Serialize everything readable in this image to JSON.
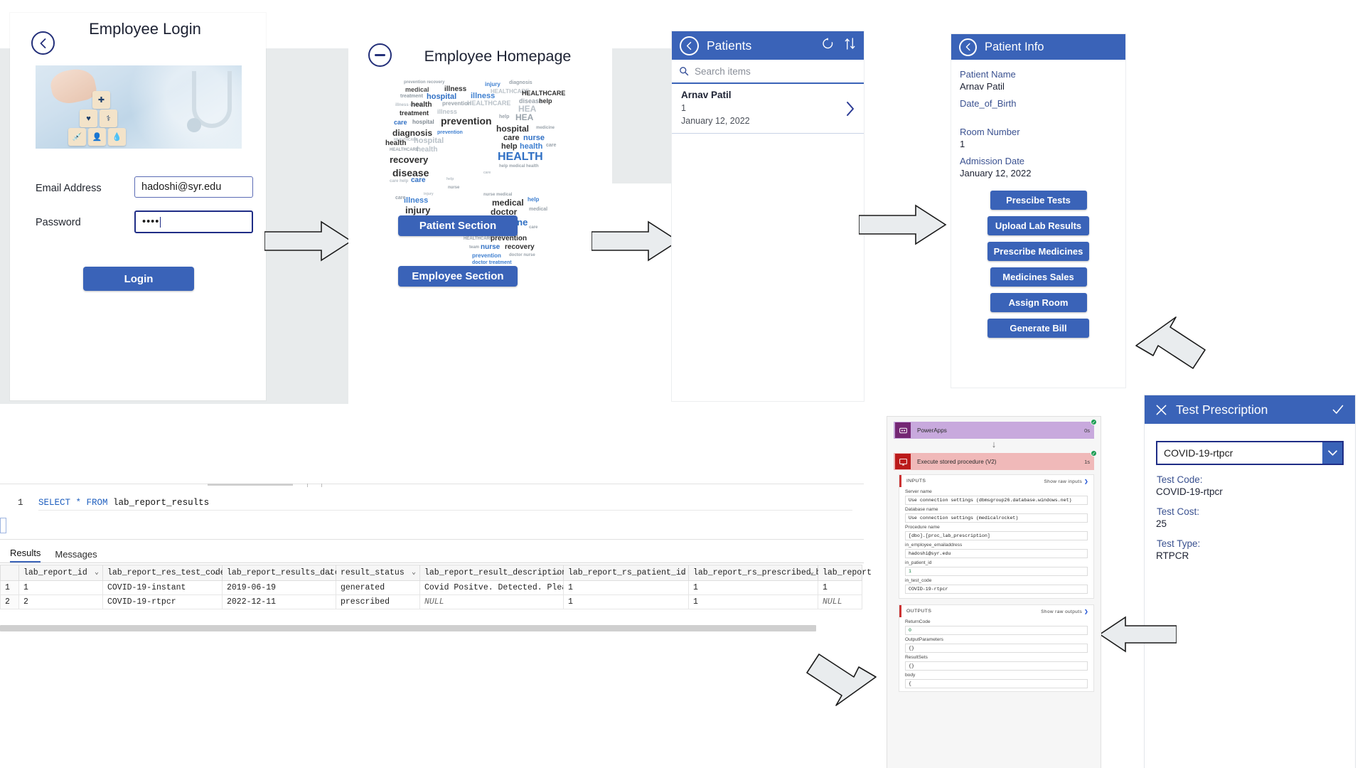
{
  "login": {
    "title": "Employee Login",
    "back_icon": "chevron-left-icon",
    "image_alt": "healthcare-blocks-photo",
    "fields": [
      {
        "label": "Email Address",
        "value": "hadoshi@syr.edu",
        "placeholder": ""
      },
      {
        "label": "Password",
        "value": "••••",
        "placeholder": ""
      }
    ],
    "submit_label": "Login"
  },
  "homepage": {
    "title": "Employee Homepage",
    "minus_icon": "minus-circle-icon",
    "buttons": [
      "Patient Section",
      "Employee Section"
    ],
    "wordcloud": {
      "image_alt": "healthcare-word-cloud-heart",
      "words": [
        "HEALTHCARE",
        "HEALTH",
        "hospital",
        "prevention",
        "treatment",
        "diagnosis",
        "recovery",
        "disease",
        "medical",
        "medicine",
        "doctor",
        "nurse",
        "illness",
        "injury",
        "care",
        "help",
        "health"
      ]
    }
  },
  "patients": {
    "title": "Patients",
    "back_icon": "chevron-left-icon",
    "refresh_icon": "refresh-icon",
    "sort_icon": "sort-icon",
    "search_placeholder": "Search items",
    "search_icon": "search-icon",
    "items": [
      {
        "name": "Arnav Patil",
        "room": "1",
        "date": "January 12, 2022",
        "chevron": "chevron-right-icon"
      }
    ]
  },
  "patient_info": {
    "title": "Patient Info",
    "back_icon": "chevron-left-icon",
    "fields": [
      {
        "label": "Patient Name",
        "value": "Arnav Patil"
      },
      {
        "label": "Date_of_Birth",
        "value": ""
      },
      {
        "label": "Room Number",
        "value": "1"
      },
      {
        "label": "Admission Date",
        "value": "January 12, 2022"
      }
    ],
    "buttons": [
      "Prescibe Tests",
      "Upload Lab Results",
      "Prescribe Medicines",
      "Medicines Sales",
      "Assign Room",
      "Generate Bill"
    ]
  },
  "test_prescription": {
    "title": "Test Prescription",
    "close_icon": "close-icon",
    "confirm_icon": "check-icon",
    "dropdown": {
      "value": "COVID-19-rtpcr",
      "chevron": "chevron-down-icon"
    },
    "fields": [
      {
        "label": "Test Code:",
        "value": "COVID-19-rtpcr"
      },
      {
        "label": "Test Cost:",
        "value": "25"
      },
      {
        "label": "Test Type:",
        "value": "RTPCR"
      }
    ]
  },
  "ssms": {
    "line_number": "1",
    "query_keywords": "SELECT * FROM",
    "query_table": "lab_report_results",
    "tabs": [
      {
        "label": "Results",
        "active": true
      },
      {
        "label": "Messages",
        "active": false
      }
    ],
    "columns": [
      "lab_report_id",
      "lab_report_res_test_code",
      "lab_report_results_date",
      "result_status",
      "lab_report_result_description",
      "lab_report_rs_patient_id",
      "lab_report_rs_prescribed_by",
      "lab_report"
    ],
    "rows": [
      {
        "n": "1",
        "cells": [
          "1",
          "COVID-19-instant",
          "2019-06-19",
          "generated",
          "Covid Positve. Detected. Please…",
          "1",
          "1",
          "1"
        ]
      },
      {
        "n": "2",
        "cells": [
          "2",
          "COVID-19-rtpcr",
          "2022-12-11",
          "prescribed",
          "NULL",
          "1",
          "1",
          "NULL"
        ]
      }
    ]
  },
  "flow": {
    "steps": [
      {
        "name": "PowerApps",
        "duration": "0s",
        "status_icon": "check-circle-icon",
        "icon": "powerapps-icon"
      },
      {
        "name": "Execute stored procedure (V2)",
        "duration": "1s",
        "status_icon": "check-circle-icon",
        "icon": "sql-server-icon"
      }
    ],
    "inputs": {
      "heading": "INPUTS",
      "raw_link": "Show raw inputs",
      "chevron": "chevron-right-icon",
      "fields": [
        {
          "key": "Server name",
          "value": "Use connection settings (dbmsgroup26.database.windows.net)"
        },
        {
          "key": "Database name",
          "value": "Use connection settings (medicalrocket)"
        },
        {
          "key": "Procedure name",
          "value": "[dbo].[proc_lab_prescription]"
        },
        {
          "key": "in_employee_emailaddress",
          "value": "hadoshi@syr.edu"
        },
        {
          "key": "in_patient_id",
          "value": "1"
        },
        {
          "key": "in_test_code",
          "value": "COVID-19-rtpcr"
        }
      ]
    },
    "outputs": {
      "heading": "OUTPUTS",
      "raw_link": "Show raw outputs",
      "chevron": "chevron-right-icon",
      "fields": [
        {
          "key": "ReturnCode",
          "value": "0"
        },
        {
          "key": "OutputParameters",
          "value": "{}"
        },
        {
          "key": "ResultSets",
          "value": "{}"
        },
        {
          "key": "body",
          "value": "{"
        }
      ]
    }
  },
  "colors": {
    "brand_blue": "#3a63b8",
    "dark_navy": "#24307a",
    "label_blue": "#3a5190",
    "grey_band": "#e8ebec"
  }
}
